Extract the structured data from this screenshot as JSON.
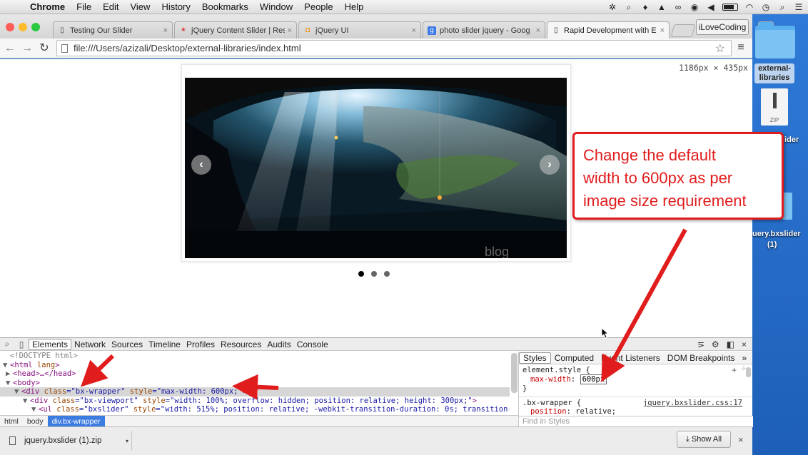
{
  "menubar": {
    "app": "Chrome",
    "items": [
      "File",
      "Edit",
      "View",
      "History",
      "Bookmarks",
      "Window",
      "People",
      "Help"
    ]
  },
  "desktop": {
    "folder_label_line1": "external-",
    "folder_label_line2": "libraries",
    "zip_icon_text": "ZIP",
    "partial_label_1": "lider",
    "partial_label_2": "uery.bxslider",
    "partial_label_3": "(1)"
  },
  "tabs": [
    {
      "title": "Testing Our Slider",
      "icon": "page-icon"
    },
    {
      "title": "jQuery Content Slider | Res",
      "icon": "red-star-icon"
    },
    {
      "title": "jQuery UI",
      "icon": "jquery-ui-icon"
    },
    {
      "title": "photo slider jquery - Goog",
      "icon": "google-icon"
    },
    {
      "title": "Rapid Development with E",
      "icon": "page-icon"
    }
  ],
  "profile_button": "iLoveCoding",
  "address_bar": {
    "url": "file:///Users/azizali/Desktop/external-libraries/index.html"
  },
  "viewport": {
    "dimensions": "1186px × 435px",
    "slider": {
      "prev_glyph": "‹",
      "next_glyph": "›",
      "watermark": "blog",
      "pager_count": 3,
      "pager_active": 1
    }
  },
  "callout": {
    "line1": "Change the default",
    "line2": "width to 600px as per",
    "line3": "image size requirement"
  },
  "devtools": {
    "tabs": [
      "Elements",
      "Network",
      "Sources",
      "Timeline",
      "Profiles",
      "Resources",
      "Audits",
      "Console"
    ],
    "active_tab": "Elements",
    "dom": {
      "doctype": "<!DOCTYPE html>",
      "html_open_tag": "<html",
      "html_attr": "lang",
      "html_close": ">",
      "head": "<head>…</head>",
      "body": "<body>",
      "div_tag": "<div",
      "ul_tag": "<ul",
      "attr_class": "class",
      "attr_style": "style",
      "eq_q": "=\"",
      "q": "\"",
      "gt": ">",
      "wrapper_class": "bx-wrapper",
      "wrapper_style": "max-width: 600px;",
      "viewport_class": "bx-viewport",
      "viewport_style": "width: 100%; overflow: hidden; position: relative; height: 300px;",
      "ul_class": "bxslider",
      "ul_style": "width: 515%; position: relative; -webkit-transition-duration: 0s; transition-"
    },
    "breadcrumbs": [
      "html",
      "body",
      "div.bx-wrapper"
    ],
    "styles_tabs": [
      "Styles",
      "Computed",
      "Event Listeners",
      "DOM Breakpoints"
    ],
    "styles": {
      "rule1_selector": "element.style {",
      "rule1_prop": "max-width",
      "rule1_value": "600px",
      "rule1_close": "}",
      "rule2_selector": ".bx-wrapper {",
      "rule2_source": "jquery.bxslider.css:17",
      "rule2_prop": "position",
      "rule2_value": "relative;",
      "find_placeholder": "Find in Styles"
    }
  },
  "download_shelf": {
    "file": "jquery.bxslider (1).zip",
    "show_all": "Show All"
  },
  "colors": {
    "annotation": "#e11c1c",
    "desktop": "#2a6fc9",
    "selected_crumb": "#3c7be0"
  }
}
